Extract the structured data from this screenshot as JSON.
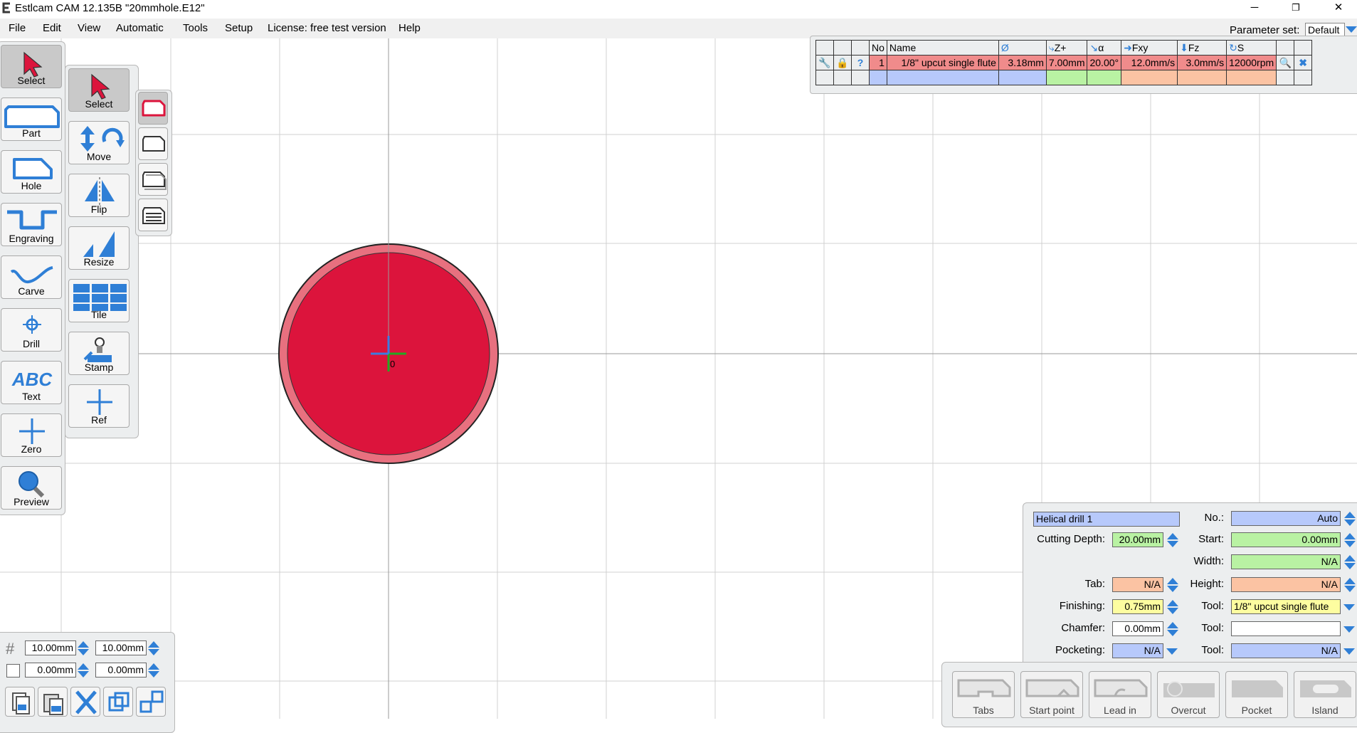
{
  "window": {
    "title": "Estlcam CAM 12.135B \"20mmhole.E12\"",
    "minimize": "─",
    "restore": "❐",
    "close": "✕"
  },
  "menu": [
    "File",
    "Edit",
    "View",
    "Automatic",
    "Tools",
    "Setup",
    "License: free test version",
    "Help"
  ],
  "parameter_set": {
    "label": "Parameter set:",
    "value": "Default"
  },
  "left_toolbar": [
    "Select",
    "Part",
    "Hole",
    "Engraving",
    "Carve",
    "Drill",
    "Text",
    "Zero",
    "Preview"
  ],
  "edit_toolbar": [
    "Select",
    "Move",
    "Flip",
    "Resize",
    "Tile",
    "Stamp",
    "Ref"
  ],
  "tool_table": {
    "headers": [
      "No",
      "Name",
      "Ø",
      "Z+",
      "α",
      "Fxy",
      "Fz",
      "S"
    ],
    "row": {
      "no": "1",
      "name": "1/8\" upcut single flute",
      "diameter": "3.18mm",
      "zplus": "7.00mm",
      "alpha": "20.00°",
      "fxy": "12.0mm/s",
      "fz": "3.0mm/s",
      "s": "12000rpm"
    },
    "help": "?"
  },
  "canvas": {
    "origin_label": "0",
    "grid_mm": 10,
    "hole_diameter_mm": 20
  },
  "properties": {
    "name": "Helical drill 1",
    "cutting_depth_label": "Cutting Depth:",
    "cutting_depth": "20.00mm",
    "tab_label": "Tab:",
    "tab": "N/A",
    "finishing_label": "Finishing:",
    "finishing": "0.75mm",
    "chamfer_label": "Chamfer:",
    "chamfer": "0.00mm",
    "pocketing_label": "Pocketing:",
    "pocketing": "N/A",
    "no_label": "No.:",
    "no": "Auto",
    "start_label": "Start:",
    "start": "0.00mm",
    "width_label": "Width:",
    "width": "N/A",
    "height_label": "Height:",
    "height": "N/A",
    "tool_label": "Tool:",
    "tool1": "1/8\" upcut single flute",
    "tool2": "",
    "tool3": "N/A"
  },
  "path_buttons": [
    "Tabs",
    "Start point",
    "Lead in",
    "Overcut",
    "Pocket",
    "Island"
  ],
  "grid_settings": {
    "x": "10.00mm",
    "y": "10.00mm",
    "ox": "0.00mm",
    "oy": "0.00mm"
  },
  "colors": {
    "hole_fill": "#dc143c",
    "hole_ring": "#e8707f",
    "accent": "#2f7fd6"
  }
}
